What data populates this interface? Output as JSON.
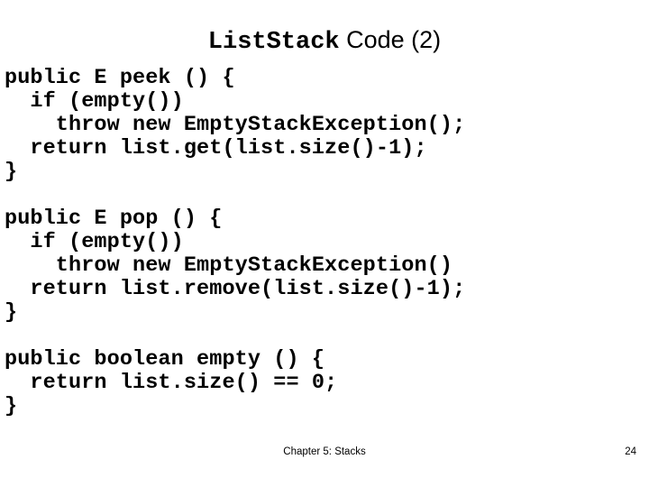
{
  "slide": {
    "title": {
      "mono_part": "ListStack",
      "sans_part": " Code (2)"
    },
    "code_lines": [
      "public E peek () {",
      "  if (empty())",
      "    throw new EmptyStackException();",
      "  return list.get(list.size()-1);",
      "}",
      "",
      "public E pop () {",
      "  if (empty())",
      "    throw new EmptyStackException()",
      "  return list.remove(list.size()-1);",
      "}",
      "",
      "public boolean empty () {",
      "  return list.size() == 0;",
      "}"
    ],
    "footer": {
      "text": "Chapter 5: Stacks",
      "page_number": "24"
    },
    "colors": {
      "background": "#ffffff",
      "text": "#000000"
    }
  }
}
